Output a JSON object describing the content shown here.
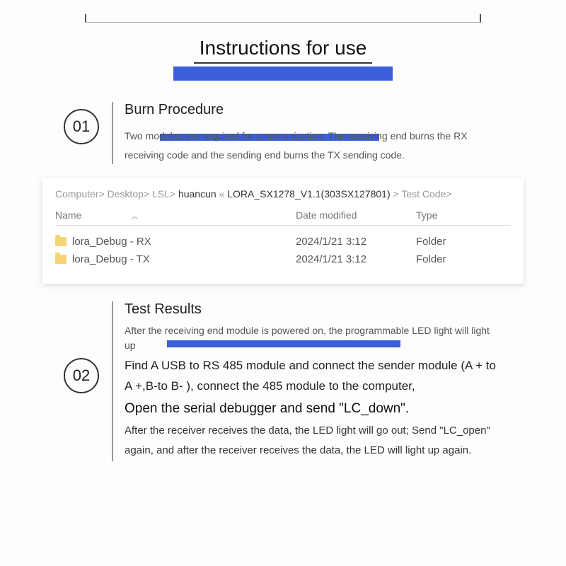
{
  "title": "Instructions for use",
  "step1": {
    "num": "01",
    "title": "Burn Procedure",
    "desc": "Two modules are required for communication. The receiving end burns the RX receiving code and the sending end burns the TX sending code."
  },
  "explorer": {
    "breadcrumb": {
      "p1": "Computer> Desktop> LSL> ",
      "p2": "huancun",
      "sep": " « ",
      "p3": "LORA_SX1278_V1.1(303SX127801)",
      "p4": "> Test Code>"
    },
    "columns": {
      "name": "Name",
      "date": "Date modified",
      "type": "Type"
    },
    "rows": [
      {
        "name": "lora_Debug - RX",
        "date": "2024/1/21 3:12",
        "type": "Folder"
      },
      {
        "name": "lora_Debug - TX",
        "date": "2024/1/21 3:12",
        "type": "Folder"
      }
    ]
  },
  "step2": {
    "num": "02",
    "title": "Test Results",
    "p1": "After the receiving end module is powered on, the programmable LED light will light up",
    "p2": "Find A USB to RS 485 module and connect the sender module (A + to A +,B-to B- ), connect the 485 module to the computer,",
    "p3": "Open the serial debugger and send \"LC_down\".",
    "p4": "After the receiver receives the data, the LED light will go out; Send \"LC_open\" again, and after the receiver receives the data, the LED will light up again."
  }
}
